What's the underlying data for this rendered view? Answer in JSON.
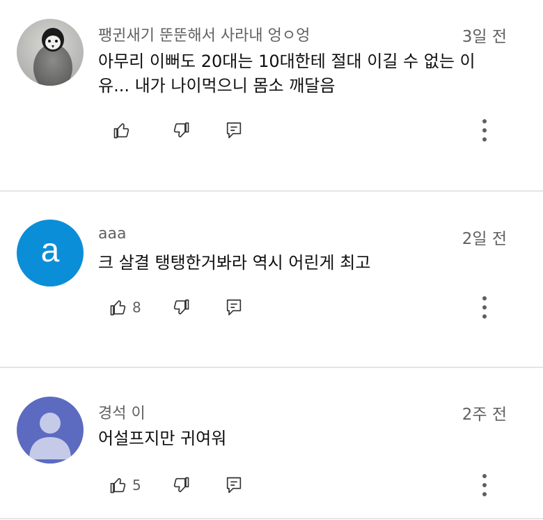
{
  "comments": [
    {
      "author": "팽귄새기 뚠뚠해서 사라내 엉ㅇ엉",
      "time": "3일 전",
      "text": "아무리 이뻐도 20대는 10대한테 절대 이길 수 없는 이유... 내가 나이먹으니 몸소 깨달음",
      "likes": "",
      "avatar": "penguin-photo"
    },
    {
      "author": "aaa",
      "time": "2일 전",
      "text": "크 살결 탱탱한거봐라 역시 어린게 최고",
      "likes": "8",
      "avatar_letter": "a",
      "avatar_color": "#0b8ed8"
    },
    {
      "author": "경석 이",
      "time": "2주 전",
      "text": "어설프지만 귀여워",
      "likes": "5",
      "avatar_color": "#5c6bc0"
    }
  ],
  "icons": [
    "thumb-up-icon",
    "thumb-down-icon",
    "reply-icon",
    "more-vert-icon"
  ],
  "colors": {
    "background": "#ffffff",
    "secondary_text": "#606060",
    "primary_text": "#0f0f0f",
    "divider": "#e5e5e5"
  }
}
